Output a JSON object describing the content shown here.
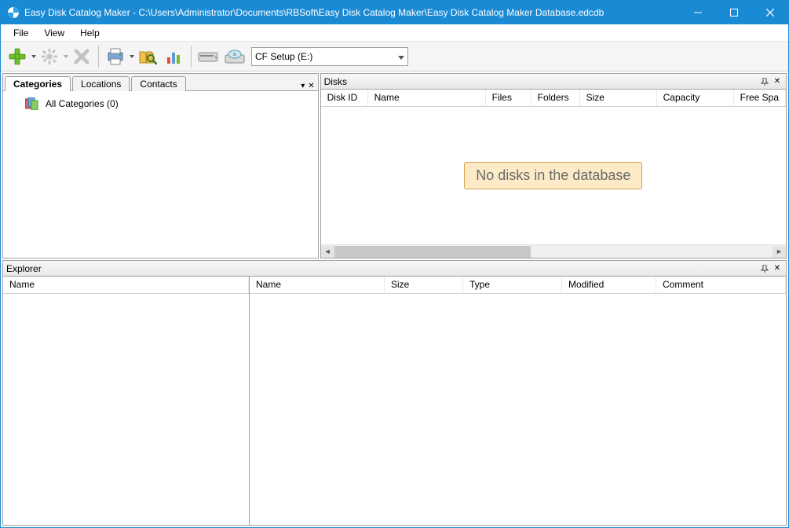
{
  "titlebar": {
    "title": "Easy Disk Catalog Maker - C:\\Users\\Administrator\\Documents\\RBSoft\\Easy Disk Catalog Maker\\Easy Disk Catalog Maker Database.edcdb"
  },
  "menu": {
    "file": "File",
    "view": "View",
    "help": "Help"
  },
  "toolbar": {
    "drive_combo": "CF Setup (E:)"
  },
  "left_panel": {
    "tabs": {
      "categories": "Categories",
      "locations": "Locations",
      "contacts": "Contacts"
    },
    "tree": {
      "root_label": "All Categories (0)"
    }
  },
  "disks_panel": {
    "title": "Disks",
    "columns": {
      "disk_id": "Disk ID",
      "name": "Name",
      "files": "Files",
      "folders": "Folders",
      "size": "Size",
      "capacity": "Capacity",
      "free_space": "Free Spa"
    },
    "empty_message": "No disks in the database"
  },
  "explorer_panel": {
    "title": "Explorer",
    "left_columns": {
      "name": "Name"
    },
    "right_columns": {
      "name": "Name",
      "size": "Size",
      "type": "Type",
      "modified": "Modified",
      "comment": "Comment"
    }
  }
}
